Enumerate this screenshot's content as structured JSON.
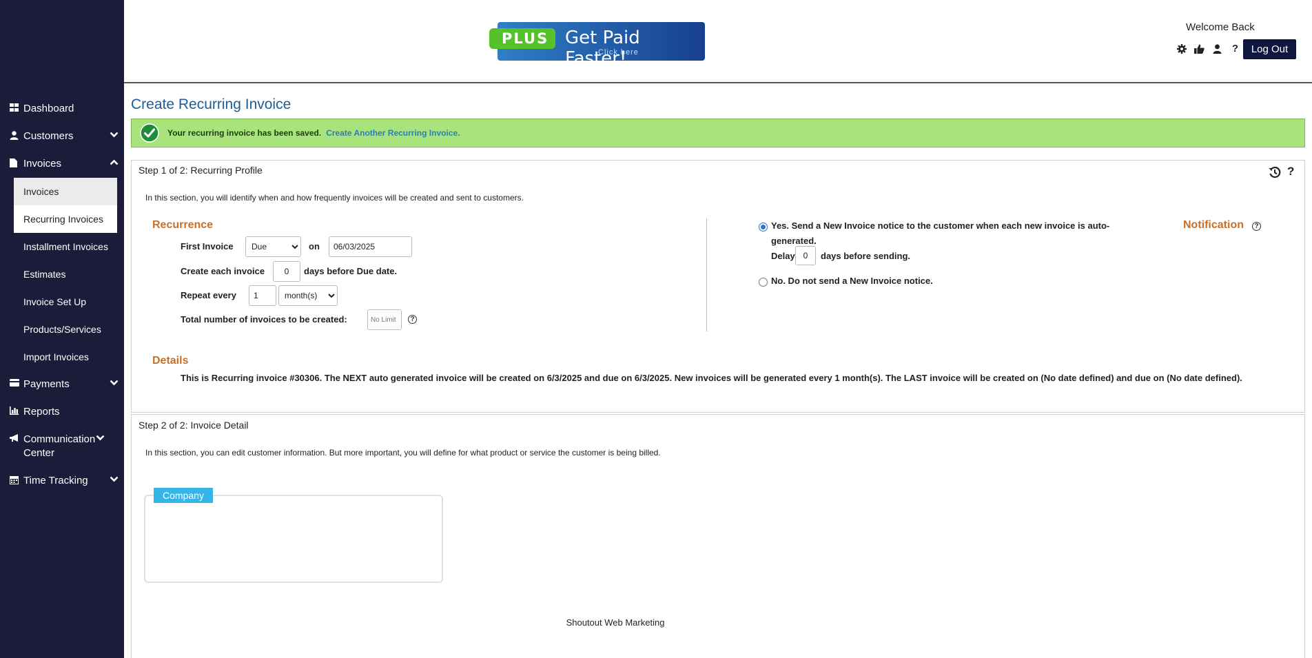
{
  "sidebar": {
    "items": [
      {
        "label": "Dashboard",
        "icon": "dashboard-icon"
      },
      {
        "label": "Customers",
        "icon": "user-icon"
      },
      {
        "label": "Invoices",
        "icon": "file-icon"
      },
      {
        "label": "Payments",
        "icon": "credit-card-icon"
      },
      {
        "label": "Reports",
        "icon": "bar-chart-icon"
      },
      {
        "label": "Communication Center",
        "icon": "megaphone-icon"
      },
      {
        "label": "Time Tracking",
        "icon": "calendar-icon"
      }
    ],
    "invoice_subitems": [
      "Invoices",
      "Recurring Invoices",
      "Installment Invoices",
      "Estimates",
      "Invoice Set Up",
      "Products/Services",
      "Import Invoices"
    ]
  },
  "header": {
    "banner": {
      "badge": "PLUS",
      "headline": "Get Paid Faster!",
      "cta": "Click here"
    },
    "welcome": "Welcome Back",
    "icons": [
      "gear-icon",
      "thumbs-up-icon",
      "user-icon",
      "question-icon"
    ],
    "logout_label": "Log Out"
  },
  "page": {
    "title": "Create Recurring Invoice",
    "alert": {
      "message": "Your recurring invoice has been saved.",
      "link": "Create Another Recurring Invoice."
    }
  },
  "step1": {
    "title": "Step 1 of 2: Recurring Profile",
    "intro": "In this section, you will identify when and how frequently invoices will be created and sent to customers.",
    "recurrence": {
      "heading": "Recurrence",
      "first_invoice_label": "First Invoice",
      "first_invoice_select": "Due",
      "on_label": "on",
      "first_invoice_date": "06/03/2025",
      "create_each_label": "Create each invoice",
      "days_before_value": "0",
      "days_before_label": "days before Due date.",
      "repeat_label": "Repeat every",
      "repeat_value": "1",
      "repeat_unit": "month(s)",
      "total_label": "Total number of invoices to be created:",
      "total_placeholder": "No Limit"
    },
    "notification": {
      "heading": "Notification",
      "yes_text": "Yes. Send a New Invoice notice to the customer when each new invoice is auto-generated.",
      "delay_label": "Delay",
      "delay_value": "0",
      "delay_suffix": "days before sending.",
      "no_text": "No. Do not send a New Invoice notice."
    },
    "details": {
      "heading": "Details",
      "text": "This is Recurring invoice #30306. The NEXT auto generated invoice will be created on 6/3/2025 and due on 6/3/2025. New invoices will be generated every 1 month(s). The LAST invoice will be created on (No date defined) and due on (No date defined)."
    }
  },
  "step2": {
    "title": "Step 2 of 2: Invoice Detail",
    "intro": "In this section, you can edit customer information. But more important, you will define for what product or service the customer is being billed.",
    "company_tab": "Company",
    "company_name": "Shoutout Web Marketing"
  }
}
